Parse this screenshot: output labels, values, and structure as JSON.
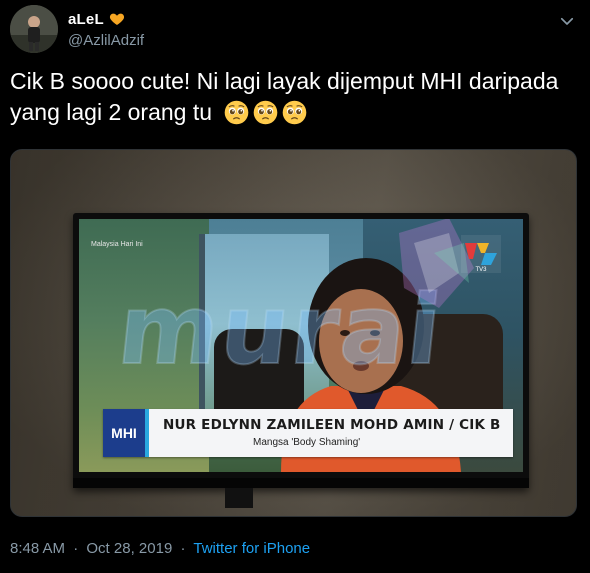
{
  "author": {
    "display_name": "aLeL",
    "handle": "@AzlilAdzif",
    "badge_icon": "orange-heart-icon",
    "avatar_icon": "avatar-photo"
  },
  "menu_icon": "chevron-down-icon",
  "tweet": {
    "text": "Cik B soooo cute! Ni lagi layak dijemput MHI daripada yang lagi 2 orang tu",
    "emojis": [
      "pleading-face-icon",
      "pleading-face-icon",
      "pleading-face-icon"
    ]
  },
  "media": {
    "watermark": "murai",
    "channel_label": "Malaysia Hari Ini",
    "tv3_label": "TV3",
    "show_badge": "MHI",
    "lower_third_name": "NUR EDLYNN ZAMILEEN MOHD AMIN / CIK B",
    "lower_third_caption": "Mangsa 'Body Shaming'"
  },
  "footer": {
    "time": "8:48 AM",
    "separator": "·",
    "date": "Oct 28, 2019",
    "source": "Twitter for iPhone"
  },
  "colors": {
    "background": "#000000",
    "handle": "#8899a6",
    "link": "#1da1f2",
    "mhi_blue": "#1c3d8c"
  }
}
